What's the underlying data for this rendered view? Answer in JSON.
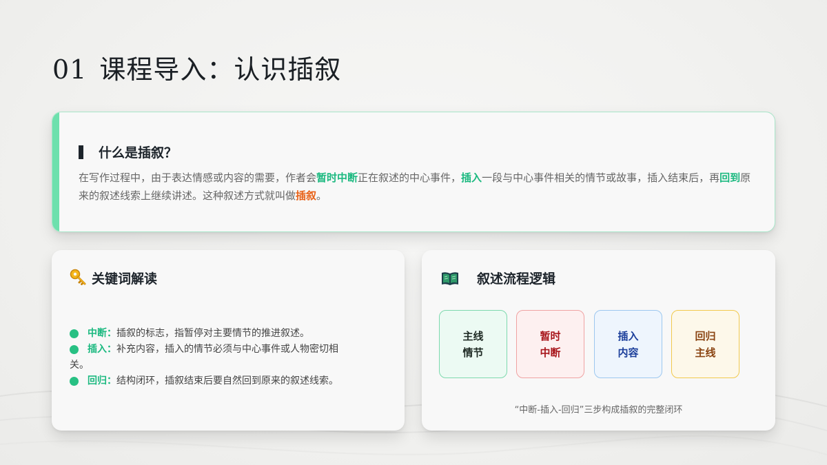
{
  "title": {
    "number": "01",
    "text": "课程导入：认识插叙"
  },
  "intro": {
    "heading": "什么是插叙？",
    "paragraph": {
      "part1": "在写作过程中，由于表达情感或内容的需要，作者会",
      "hl1": "暂时中断",
      "part2": "正在叙述的中心事件，",
      "hl2": "插入",
      "part3": "一段与中心事件相关的情节或故事，插入结束后，再",
      "hl3": "回到",
      "part4": "原来的叙述线索上继续讲述。这种叙述方式就叫做",
      "hl4": "插叙",
      "part5": "。"
    }
  },
  "keywords": {
    "icon": "key-icon",
    "heading": "关键词解读",
    "items": [
      {
        "term": "中断：",
        "desc": "插叙的标志，指暂停对主要情节的推进叙述。"
      },
      {
        "term": "插入：",
        "desc_line1": "补充内容，插入的情节必须与中心事件或人物密切相",
        "desc_line2": "关。"
      },
      {
        "term": "回归：",
        "desc": "结构闭环，插叙结束后要自然回到原来的叙述线索。"
      }
    ]
  },
  "flow": {
    "icon": "book-icon",
    "heading": "叙述流程逻辑",
    "steps": [
      {
        "line1": "主线",
        "line2": "情节"
      },
      {
        "line1": "暂时",
        "line2": "中断"
      },
      {
        "line1": "插入",
        "line2": "内容"
      },
      {
        "line1": "回归",
        "line2": "主线"
      }
    ],
    "caption": "“中断-插入-回归”三步构成插叙的完整闭环"
  },
  "colors": {
    "accent_green": "#6ee0ad",
    "highlight_green": "#1cb980",
    "highlight_orange": "#e8631a"
  }
}
